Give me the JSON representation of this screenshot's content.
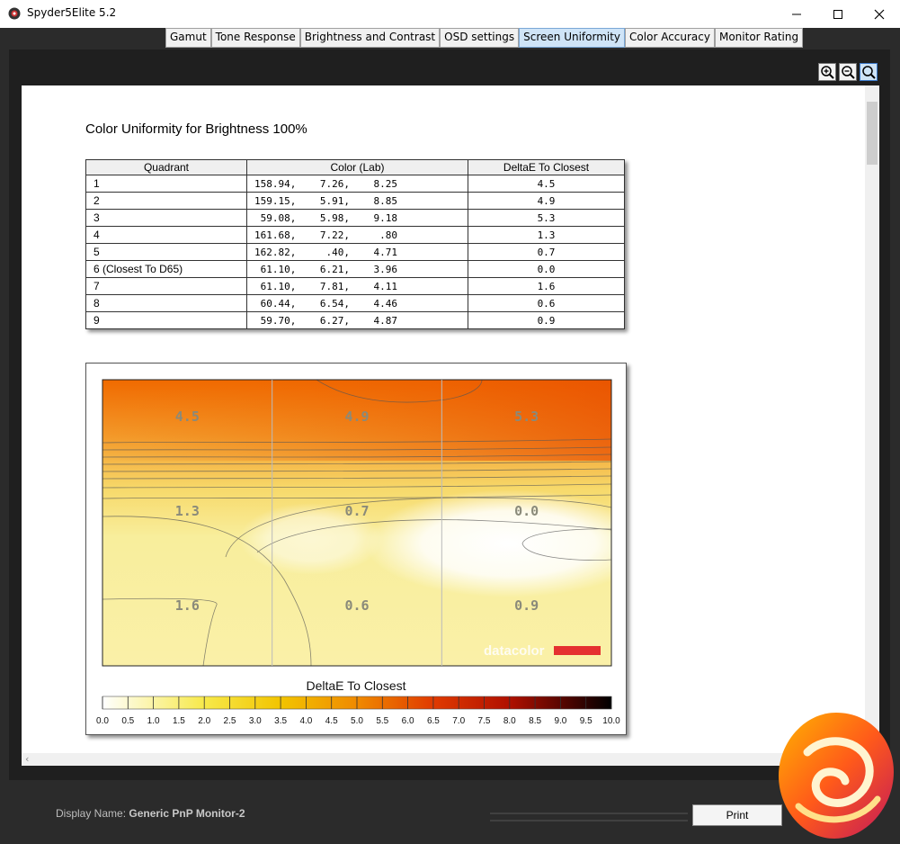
{
  "window": {
    "title": "Spyder5Elite 5.2"
  },
  "tabs": [
    {
      "label": "Gamut"
    },
    {
      "label": "Tone Response"
    },
    {
      "label": "Brightness and Contrast"
    },
    {
      "label": "OSD settings"
    },
    {
      "label": "Screen Uniformity"
    },
    {
      "label": "Color Accuracy"
    },
    {
      "label": "Monitor Rating"
    }
  ],
  "report": {
    "title": "Color Uniformity for Brightness 100%",
    "columns": [
      "Quadrant",
      "Color (Lab)",
      "DeltaE To Closest"
    ],
    "rows": [
      {
        "quadrant": "1",
        "lab": "158.94,    7.26,    8.25",
        "de": "4.5"
      },
      {
        "quadrant": "2",
        "lab": "159.15,    5.91,    8.85",
        "de": "4.9"
      },
      {
        "quadrant": "3",
        "lab": " 59.08,    5.98,    9.18",
        "de": "5.3"
      },
      {
        "quadrant": "4",
        "lab": "161.68,    7.22,     .80",
        "de": "1.3"
      },
      {
        "quadrant": "5",
        "lab": "162.82,     .40,    4.71",
        "de": "0.7"
      },
      {
        "quadrant": "6 (Closest To D65)",
        "lab": " 61.10,    6.21,    3.96",
        "de": "0.0"
      },
      {
        "quadrant": "7",
        "lab": " 61.10,    7.81,    4.11",
        "de": "1.6"
      },
      {
        "quadrant": "8",
        "lab": " 60.44,    6.54,    4.46",
        "de": "0.6"
      },
      {
        "quadrant": "9",
        "lab": " 59.70,    6.27,    4.87",
        "de": "0.9"
      }
    ]
  },
  "chart_data": {
    "type": "heatmap",
    "grid": [
      [
        "4.5",
        "4.9",
        "5.3"
      ],
      [
        "1.3",
        "0.7",
        "0.0"
      ],
      [
        "1.6",
        "0.6",
        "0.9"
      ]
    ],
    "values": [
      [
        4.5,
        4.9,
        5.3
      ],
      [
        1.3,
        0.7,
        0.0
      ],
      [
        1.6,
        0.6,
        0.9
      ]
    ],
    "legend_title": "DeltaE To Closest",
    "scale_ticks": [
      "0.0",
      "0.5",
      "1.0",
      "1.5",
      "2.0",
      "2.5",
      "3.0",
      "3.5",
      "4.0",
      "4.5",
      "5.0",
      "5.5",
      "6.0",
      "6.5",
      "7.0",
      "7.5",
      "8.0",
      "8.5",
      "9.0",
      "9.5",
      "10.0"
    ],
    "scale_range": [
      0,
      10
    ],
    "watermark": "datacolor",
    "colors": {
      "low": "#ffffff",
      "mid": "#f2d000",
      "high": "#e02000",
      "max": "#000000"
    }
  },
  "footer": {
    "display_label": "Display Name:",
    "display_value": "Generic PnP Monitor-2",
    "print_label": "Print"
  }
}
